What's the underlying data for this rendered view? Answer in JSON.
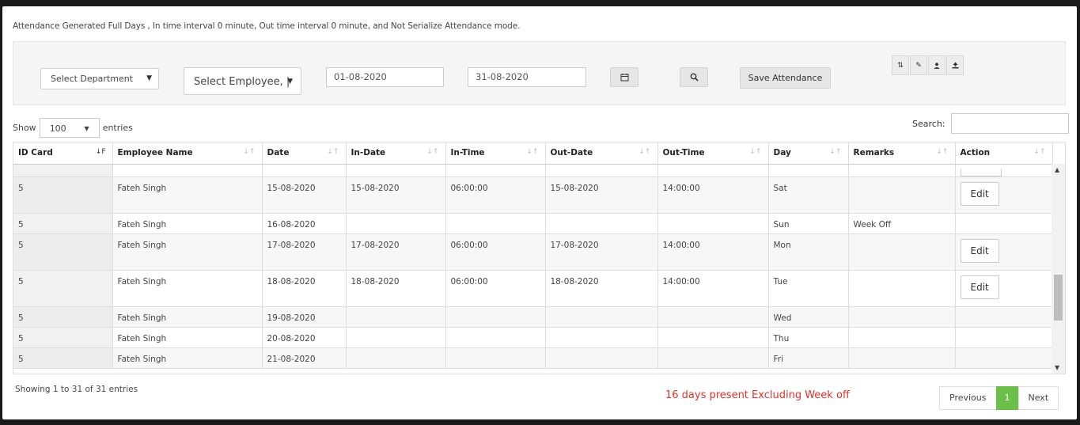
{
  "notice": "Attendance Generated Full Days , In time interval 0 minute, Out time interval 0 minute, and Not Serialize Attendance mode.",
  "filters": {
    "department": "Select Department",
    "employee": "Select Employee, |",
    "from_date": "01-08-2020",
    "to_date": "31-08-2020",
    "save_label": "Save Attendance"
  },
  "tools": [
    "sort-icon",
    "edit-icon",
    "user-icon",
    "upload-icon"
  ],
  "length_menu": {
    "show": "Show",
    "value": "100",
    "entries": "entries"
  },
  "search_label": "Search:",
  "table": {
    "headers": [
      "ID Card",
      "Employee Name",
      "Date",
      "In-Date",
      "In-Time",
      "Out-Date",
      "Out-Time",
      "Day",
      "Remarks",
      "Action"
    ],
    "rows": [
      {
        "id": "5",
        "name": "Fateh Singh",
        "date": "15-08-2020",
        "in_date": "15-08-2020",
        "in_time": "06:00:00",
        "out_date": "15-08-2020",
        "out_time": "14:00:00",
        "day": "Sat",
        "remarks": "",
        "action": "Edit"
      },
      {
        "id": "5",
        "name": "Fateh Singh",
        "date": "16-08-2020",
        "in_date": "",
        "in_time": "",
        "out_date": "",
        "out_time": "",
        "day": "Sun",
        "remarks": "Week Off",
        "action": ""
      },
      {
        "id": "5",
        "name": "Fateh Singh",
        "date": "17-08-2020",
        "in_date": "17-08-2020",
        "in_time": "06:00:00",
        "out_date": "17-08-2020",
        "out_time": "14:00:00",
        "day": "Mon",
        "remarks": "",
        "action": "Edit"
      },
      {
        "id": "5",
        "name": "Fateh Singh",
        "date": "18-08-2020",
        "in_date": "18-08-2020",
        "in_time": "06:00:00",
        "out_date": "18-08-2020",
        "out_time": "14:00:00",
        "day": "Tue",
        "remarks": "",
        "action": "Edit"
      },
      {
        "id": "5",
        "name": "Fateh Singh",
        "date": "19-08-2020",
        "in_date": "",
        "in_time": "",
        "out_date": "",
        "out_time": "",
        "day": "Wed",
        "remarks": "",
        "action": ""
      },
      {
        "id": "5",
        "name": "Fateh Singh",
        "date": "20-08-2020",
        "in_date": "",
        "in_time": "",
        "out_date": "",
        "out_time": "",
        "day": "Thu",
        "remarks": "",
        "action": ""
      },
      {
        "id": "5",
        "name": "Fateh Singh",
        "date": "21-08-2020",
        "in_date": "",
        "in_time": "",
        "out_date": "",
        "out_time": "",
        "day": "Fri",
        "remarks": "",
        "action": ""
      }
    ]
  },
  "info": "Showing 1 to 31 of 31 entries",
  "present_text": "16 days present Excluding Week off",
  "pager": {
    "prev": "Previous",
    "current": "1",
    "next": "Next"
  },
  "colors": {
    "present": "#e0312c",
    "page_active": "#6cc04a"
  }
}
